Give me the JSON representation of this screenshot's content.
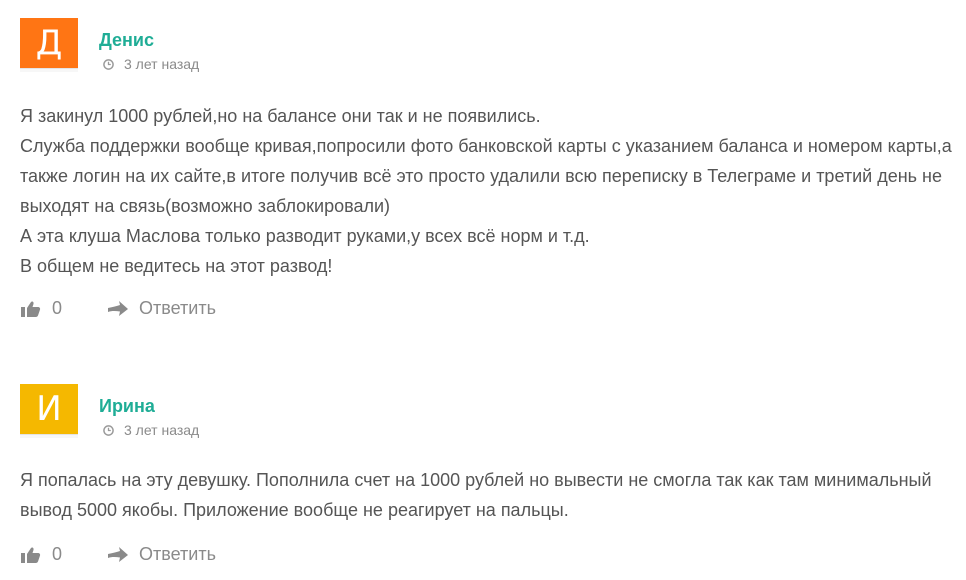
{
  "comments": [
    {
      "initial": "Д",
      "avatar_color": "#ff7514",
      "author": "Денис",
      "time": "3 лет назад",
      "text": "Я закинул 1000 рублей,но на балансе они так и не появились.\nСлужба поддержки вообще кривая,попросили фото банковской карты с указанием баланса и номером карты,а также логин на их сайте,в итоге получив всё это просто удалили всю переписку в Телеграме и третий день не выходят на связь(возможно заблокировали)\nА эта клуша Маслова только разводит руками,у всех всё норм и т.д.\nВ общем не ведитесь на этот развод!",
      "likes": "0",
      "reply_label": "Ответить"
    },
    {
      "initial": "И",
      "avatar_color": "#f5b800",
      "author": "Ирина",
      "time": "3 лет назад",
      "text": "Я попалась на эту девушку. Пополнила счет на 1000 рублей но вывести не смогла так как там минимальный вывод 5000 якобы. Приложение вообще не реагирует на пальцы.",
      "likes": "0",
      "reply_label": "Ответить"
    }
  ]
}
